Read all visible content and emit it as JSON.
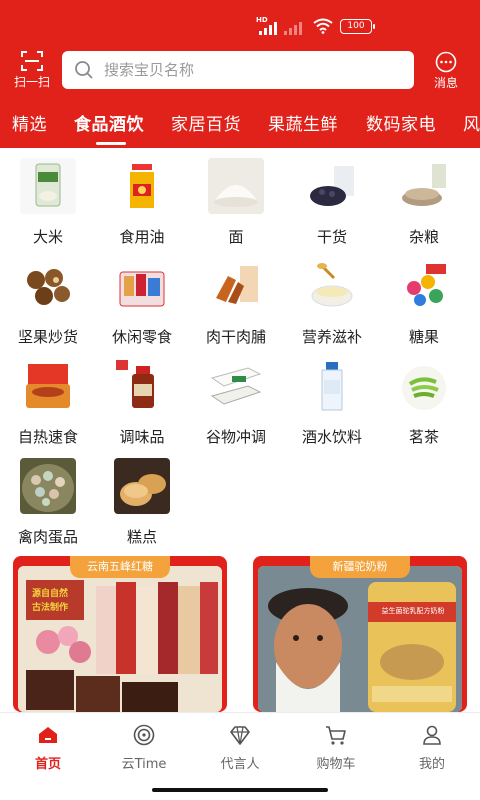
{
  "status_bar": {
    "hd": "HD",
    "battery": "100"
  },
  "header": {
    "scan_label": "扫一扫",
    "search_placeholder": "搜索宝贝名称",
    "message_label": "消息"
  },
  "tabs": [
    {
      "label": "精选"
    },
    {
      "label": "食品酒饮",
      "active": true
    },
    {
      "label": "家居百货"
    },
    {
      "label": "果蔬生鲜"
    },
    {
      "label": "数码家电"
    },
    {
      "label": "风"
    }
  ],
  "categories": [
    {
      "label": "大米",
      "icon": "rice-bag-icon"
    },
    {
      "label": "食用油",
      "icon": "oil-bottle-icon"
    },
    {
      "label": "面",
      "icon": "flour-icon"
    },
    {
      "label": "干货",
      "icon": "dried-goods-icon"
    },
    {
      "label": "杂粮",
      "icon": "grains-icon"
    },
    {
      "label": "坚果炒货",
      "icon": "nuts-icon"
    },
    {
      "label": "休闲零食",
      "icon": "snack-basket-icon"
    },
    {
      "label": "肉干肉脯",
      "icon": "jerky-icon"
    },
    {
      "label": "营养滋补",
      "icon": "nutrition-bowl-icon"
    },
    {
      "label": "糖果",
      "icon": "candy-icon"
    },
    {
      "label": "自热速食",
      "icon": "instant-food-icon"
    },
    {
      "label": "调味品",
      "icon": "seasoning-bottle-icon"
    },
    {
      "label": "谷物冲调",
      "icon": "cereal-box-icon"
    },
    {
      "label": "酒水饮料",
      "icon": "drink-bottle-icon"
    },
    {
      "label": "茗茶",
      "icon": "tea-leaves-icon"
    },
    {
      "label": "禽肉蛋品",
      "icon": "eggs-icon"
    },
    {
      "label": "糕点",
      "icon": "pastry-icon"
    }
  ],
  "banners": [
    {
      "tag": "云南五峰红糖",
      "slogan_line1": "源自自然",
      "slogan_line2": "古法制作"
    },
    {
      "tag": "新疆驼奶粉",
      "product_text": "益生菌驼乳配方奶粉"
    }
  ],
  "bottom_nav": [
    {
      "label": "首页",
      "icon": "home-icon",
      "active": true
    },
    {
      "label": "云Time",
      "icon": "cloud-time-icon"
    },
    {
      "label": "代言人",
      "icon": "diamond-icon"
    },
    {
      "label": "购物车",
      "icon": "cart-icon"
    },
    {
      "label": "我的",
      "icon": "profile-icon"
    }
  ],
  "colors": {
    "brand_red": "#e0221b",
    "tag_orange": "#f3a23c"
  }
}
